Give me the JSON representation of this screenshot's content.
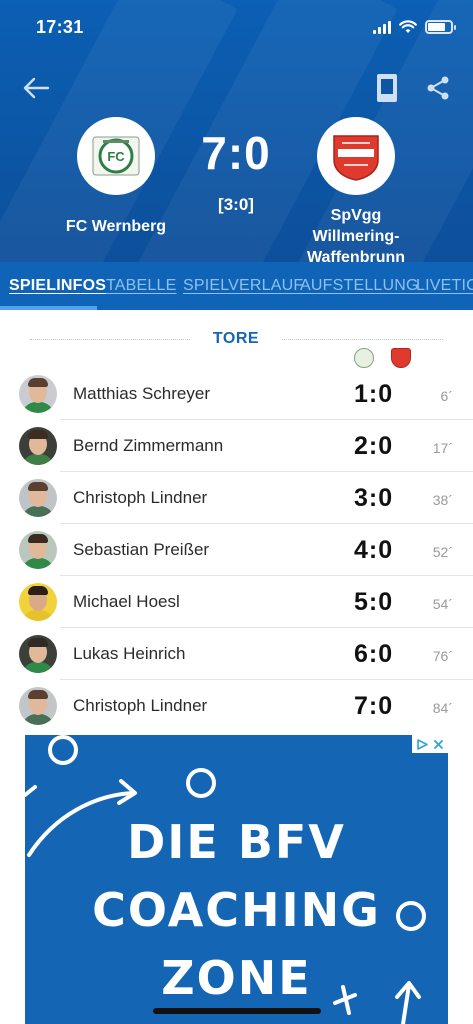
{
  "status_bar": {
    "time": "17:31"
  },
  "match": {
    "home_team": "FC Wernberg",
    "away_team": "SpVgg Willmering-Waffenbrunn",
    "score": "7:0",
    "halftime": "[3:0]",
    "home_logo_icon": "fc-wernberg-crest",
    "away_logo_icon": "spvgg-willmering-crest"
  },
  "tabs": [
    {
      "label": "SPIELINFOS",
      "active": true
    },
    {
      "label": "TABELLE"
    },
    {
      "label": "SPIELVERLAUF"
    },
    {
      "label": "AUFSTELLUNG"
    },
    {
      "label": "LIVETICK"
    }
  ],
  "goals_section": {
    "title": "TORE"
  },
  "goals": [
    {
      "player": "Matthias Schreyer",
      "score": "1:0",
      "minute": "6´"
    },
    {
      "player": "Bernd Zimmermann",
      "score": "2:0",
      "minute": "17´"
    },
    {
      "player": "Christoph Lindner",
      "score": "3:0",
      "minute": "38´"
    },
    {
      "player": "Sebastian Preißer",
      "score": "4:0",
      "minute": "52´"
    },
    {
      "player": "Michael Hoesl",
      "score": "5:0",
      "minute": "54´"
    },
    {
      "player": "Lukas Heinrich",
      "score": "6:0",
      "minute": "76´"
    },
    {
      "player": "Christoph Lindner",
      "score": "7:0",
      "minute": "84´"
    }
  ],
  "ad": {
    "line1": "DIE BFV",
    "line2": "COACHING",
    "line3": "ZONE"
  },
  "colors": {
    "header_blue": "#0b5fb4",
    "tab_bar": "#0f64b8",
    "accent": "#1566b2",
    "ad_blue": "#1565b5"
  }
}
